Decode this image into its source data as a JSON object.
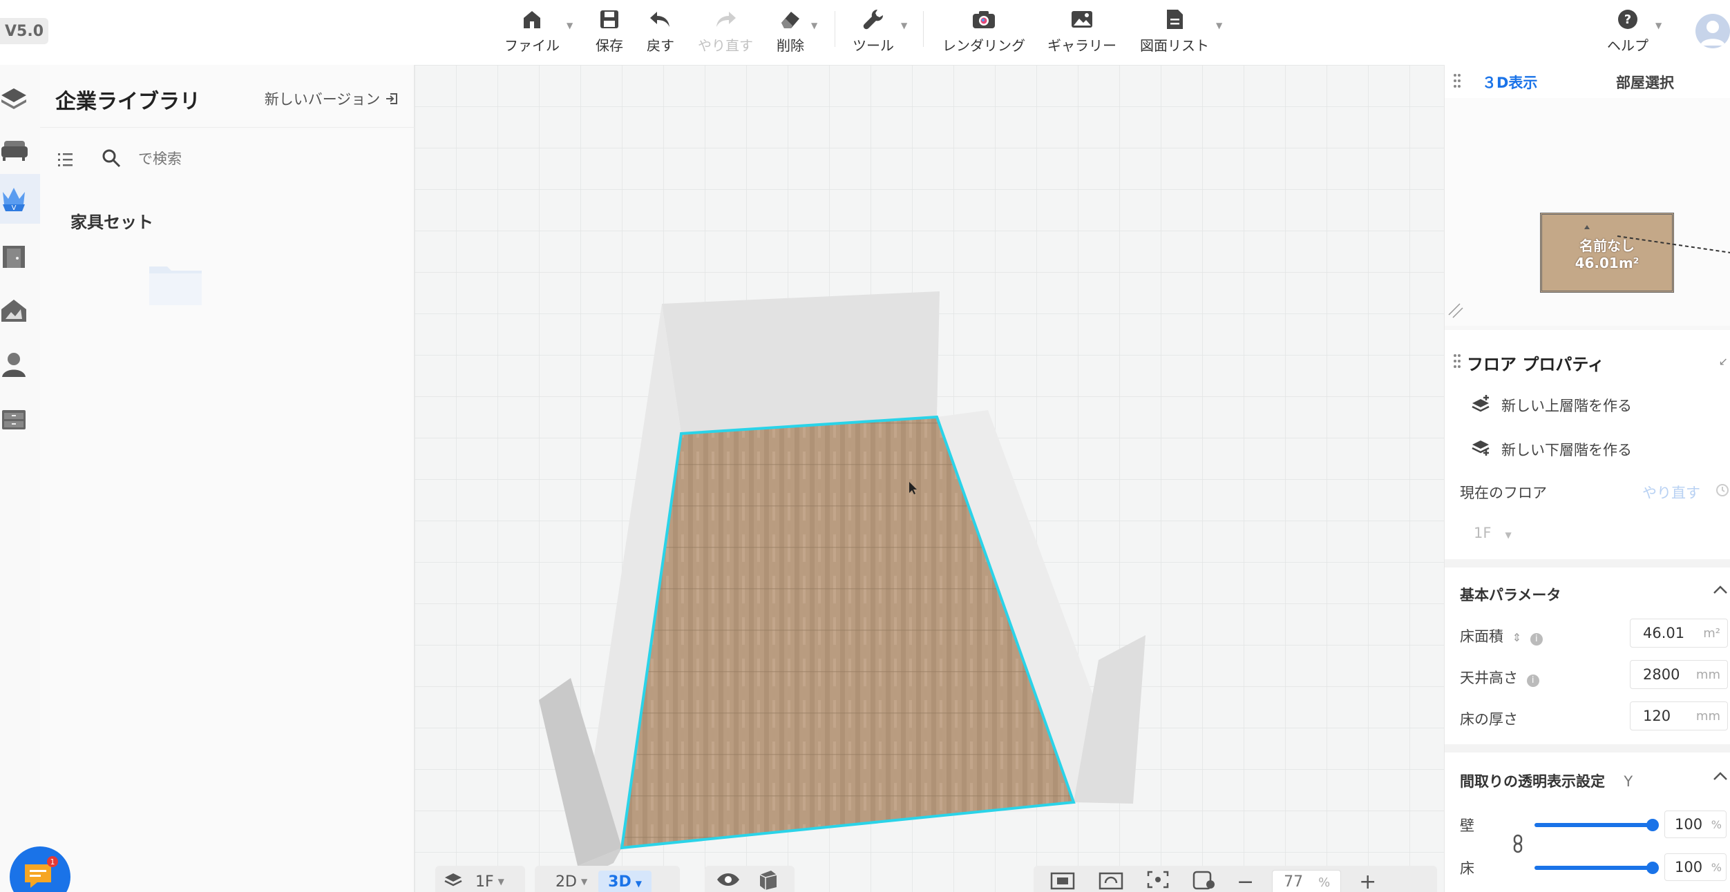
{
  "version": "V5.0",
  "toolbar": {
    "file": "ファイル",
    "save": "保存",
    "undo": "戻す",
    "redo": "やり直す",
    "delete": "削除",
    "tools": "ツール",
    "render": "レンダリング",
    "gallery": "ギャラリー",
    "drawing_list": "図面リスト",
    "help": "ヘルプ"
  },
  "library": {
    "title": "企業ライブラリ",
    "new_version": "新しいバージョン",
    "search_placeholder": "で検索",
    "category": "家具セット"
  },
  "viewport": {
    "floor_selector": "1F",
    "view_2d": "2D",
    "view_3d": "3D",
    "zoom": "77",
    "zoom_unit": "%"
  },
  "right_panel": {
    "tab_3d": "３D表示",
    "tab_room": "部屋選択",
    "room_name": "名前なし",
    "room_area": "46.01m²",
    "section_title": "フロア プロパティ",
    "new_upper_floor": "新しい上層階を作る",
    "new_lower_floor": "新しい下層階を作る",
    "current_floor_label": "現在のフロア",
    "current_floor_redo": "やり直す",
    "current_floor_value": "1F",
    "basic_params_title": "基本パラメータ",
    "floor_area_label": "床面積",
    "floor_area_value": "46.01",
    "floor_area_unit": "m²",
    "ceiling_height_label": "天井高さ",
    "ceiling_height_value": "2800",
    "ceiling_height_unit": "mm",
    "floor_thickness_label": "床の厚さ",
    "floor_thickness_value": "120",
    "floor_thickness_unit": "mm",
    "transparency_title": "間取りの透明表示設定",
    "transparency_key": "Y",
    "wall_label": "壁",
    "wall_value": "100",
    "floor_label": "床",
    "floor_value": "100",
    "percent": "%"
  },
  "colors": {
    "accent": "#1a73e8",
    "floor_outline": "#2ad3e8",
    "floor_wood": "#b99c80"
  },
  "chat_badge": "1"
}
